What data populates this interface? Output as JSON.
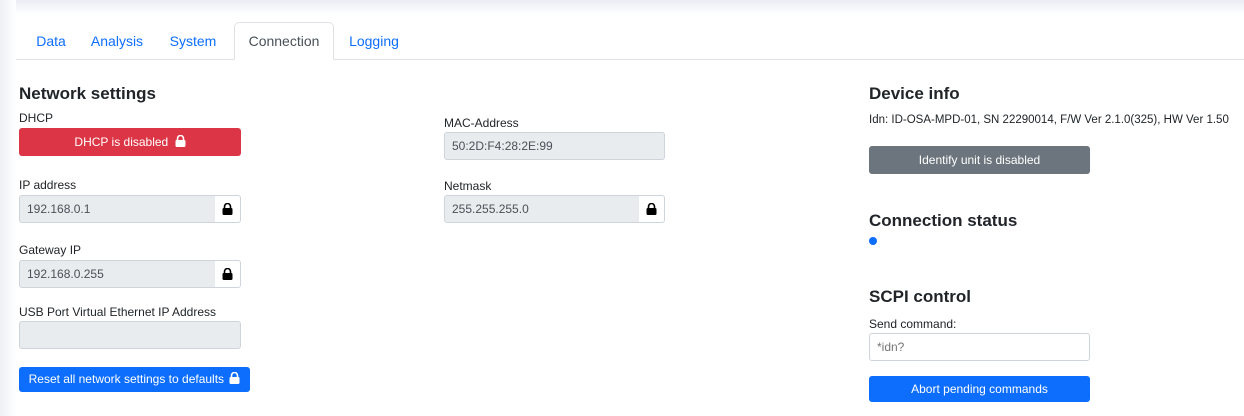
{
  "tabs": [
    "Data",
    "Analysis",
    "System",
    "Connection",
    "Logging"
  ],
  "active_tab": "Connection",
  "network": {
    "title": "Network settings",
    "dhcp_label": "DHCP",
    "dhcp_button": "DHCP is disabled",
    "ip_label": "IP address",
    "ip_value": "192.168.0.1",
    "gateway_label": "Gateway IP",
    "gateway_value": "192.168.0.255",
    "usb_label": "USB Port Virtual Ethernet IP Address",
    "usb_value": "",
    "reset_button": "Reset all network settings to defaults",
    "mac_label": "MAC-Address",
    "mac_value": "50:2D:F4:28:2E:99",
    "netmask_label": "Netmask",
    "netmask_value": "255.255.255.0"
  },
  "device": {
    "title": "Device info",
    "idn": "Idn: ID-OSA-MPD-01, SN 22290014, F/W Ver 2.1.0(325), HW Ver 1.50",
    "identify_button": "Identify unit is disabled"
  },
  "connection": {
    "title": "Connection status"
  },
  "scpi": {
    "title": "SCPI control",
    "send_label": "Send command:",
    "command_placeholder": "*idn?",
    "abort_button": "Abort pending commands"
  },
  "colors": {
    "danger": "#dc3545",
    "secondary": "#6c757d",
    "primary": "#0d6efd"
  }
}
